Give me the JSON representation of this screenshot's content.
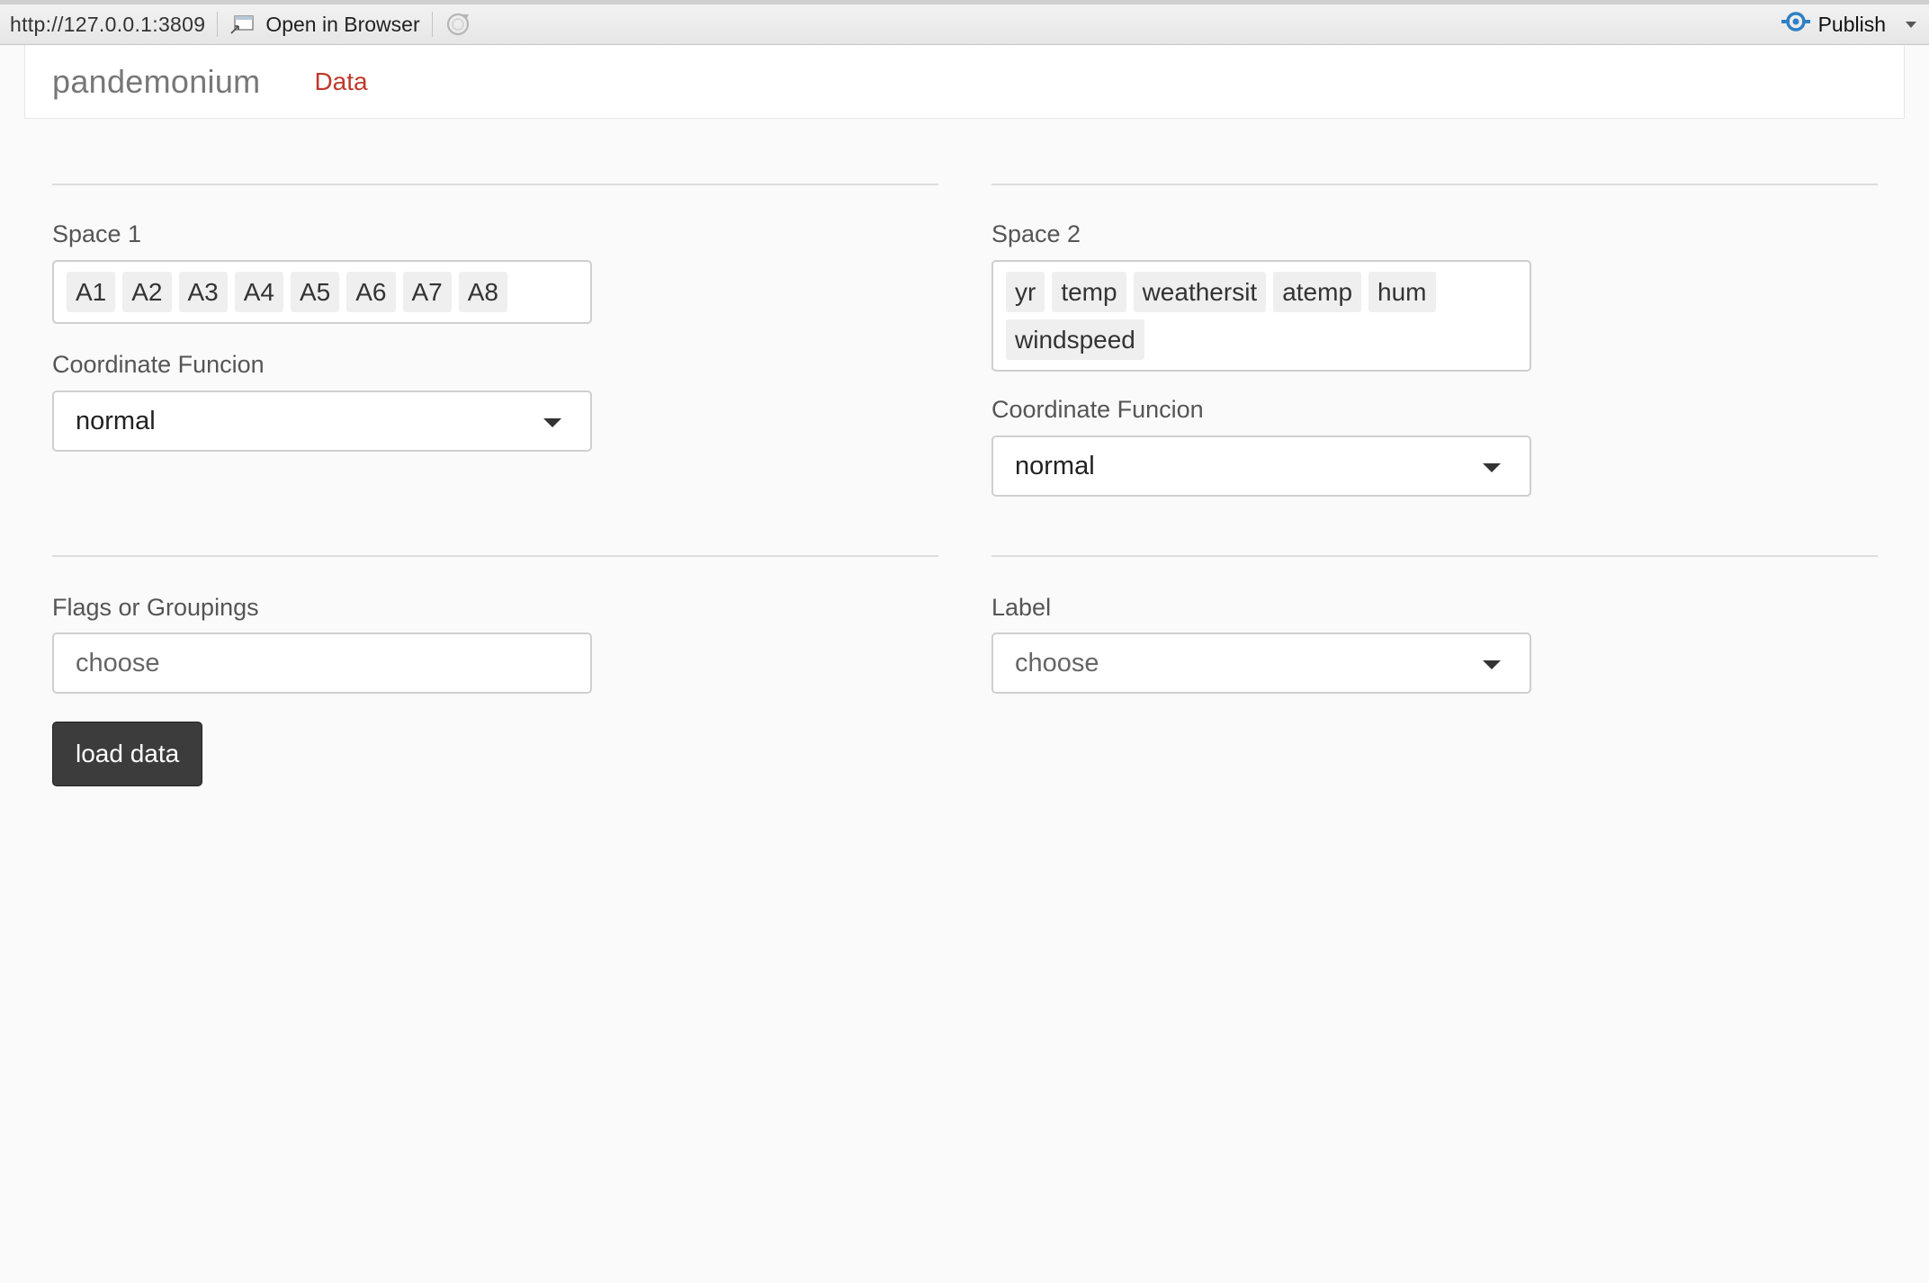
{
  "viewer": {
    "url": "http://127.0.0.1:3809",
    "open_in_browser": "Open in Browser",
    "publish": "Publish"
  },
  "navbar": {
    "brand": "pandemonium",
    "tabs": [
      {
        "label": "Data",
        "active": true
      }
    ]
  },
  "space1": {
    "label": "Space 1",
    "selected": [
      "A1",
      "A2",
      "A3",
      "A4",
      "A5",
      "A6",
      "A7",
      "A8"
    ],
    "coord_label": "Coordinate Funcion",
    "coord_value": "normal"
  },
  "space2": {
    "label": "Space 2",
    "selected": [
      "yr",
      "temp",
      "weathersit",
      "atemp",
      "hum",
      "windspeed"
    ],
    "coord_label": "Coordinate Funcion",
    "coord_value": "normal"
  },
  "flags": {
    "label": "Flags or Groupings",
    "placeholder": "choose"
  },
  "label_select": {
    "label": "Label",
    "placeholder": "choose"
  },
  "load_button": "load data",
  "colors": {
    "nav_active": "#c0392b",
    "button_bg": "#3c3c3c",
    "page_bg": "#fafafa",
    "publish_icon": "#2f80c4"
  }
}
